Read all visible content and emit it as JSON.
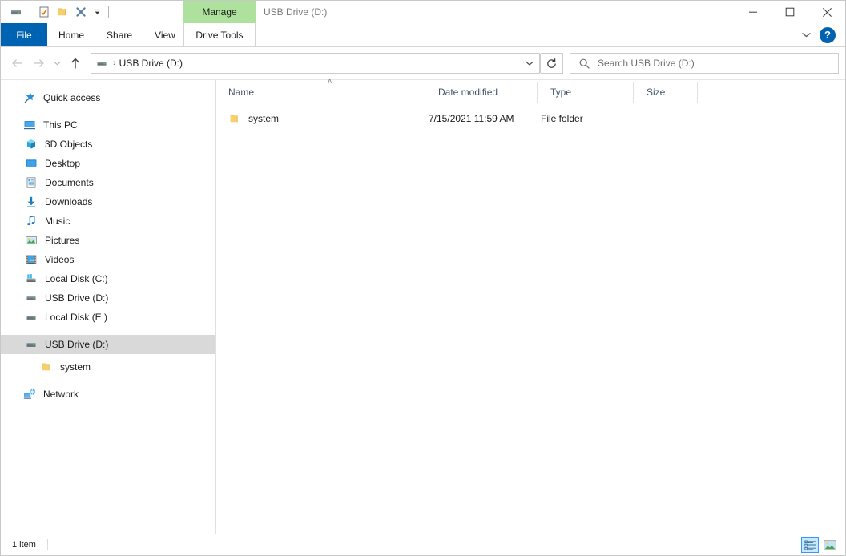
{
  "window": {
    "title": "USB Drive (D:)",
    "accent_blue": "#0063b1",
    "contextual_tab_green": "#aee19e",
    "selection_gray": "#d9d9d9"
  },
  "quick_access_toolbar": {
    "items": [
      {
        "name": "drive-icon",
        "label": "Properties"
      },
      {
        "name": "properties-icon",
        "label": "Properties"
      },
      {
        "name": "new-folder-icon",
        "label": "New folder"
      },
      {
        "name": "delete-icon",
        "label": "Delete"
      },
      {
        "name": "customize-dropdown-icon",
        "label": "Customize Quick Access Toolbar"
      }
    ]
  },
  "contextual_tab": {
    "group_label": "Manage",
    "tab_label": "Drive Tools"
  },
  "window_controls": {
    "minimize": "—",
    "maximize": "□",
    "close": "✕",
    "ribbon_collapse": "chevron-down-icon",
    "help": "?"
  },
  "ribbon": {
    "tabs": [
      {
        "label": "File",
        "active": false,
        "style": "file"
      },
      {
        "label": "Home",
        "active": false,
        "style": "normal"
      },
      {
        "label": "Share",
        "active": false,
        "style": "normal"
      },
      {
        "label": "View",
        "active": false,
        "style": "normal"
      }
    ]
  },
  "navigation": {
    "back_label": "Back",
    "forward_label": "Forward",
    "recent_label": "Recent locations",
    "up_label": "Up one level",
    "breadcrumb": {
      "icon": "drive-icon",
      "separator": "›",
      "path": "USB Drive (D:)"
    },
    "dropdown_label": "Previous locations",
    "refresh_label": "Refresh"
  },
  "search": {
    "placeholder": "Search USB Drive (D:)",
    "value": "",
    "icon": "search-icon"
  },
  "sidebar": {
    "items": [
      {
        "label": "Quick access",
        "icon": "star-pin-icon",
        "indent": 0,
        "selected": false,
        "gap_after": true
      },
      {
        "label": "This PC",
        "icon": "this-pc-icon",
        "indent": 0,
        "selected": false,
        "gap_after": false
      },
      {
        "label": "3D Objects",
        "icon": "3d-objects-icon",
        "indent": 1,
        "selected": false,
        "gap_after": false
      },
      {
        "label": "Desktop",
        "icon": "desktop-icon",
        "indent": 1,
        "selected": false,
        "gap_after": false
      },
      {
        "label": "Documents",
        "icon": "documents-icon",
        "indent": 1,
        "selected": false,
        "gap_after": false
      },
      {
        "label": "Downloads",
        "icon": "downloads-icon",
        "indent": 1,
        "selected": false,
        "gap_after": false
      },
      {
        "label": "Music",
        "icon": "music-icon",
        "indent": 1,
        "selected": false,
        "gap_after": false
      },
      {
        "label": "Pictures",
        "icon": "pictures-icon",
        "indent": 1,
        "selected": false,
        "gap_after": false
      },
      {
        "label": "Videos",
        "icon": "videos-icon",
        "indent": 1,
        "selected": false,
        "gap_after": false
      },
      {
        "label": "Local Disk (C:)",
        "icon": "system-drive-icon",
        "indent": 1,
        "selected": false,
        "gap_after": false
      },
      {
        "label": "USB Drive (D:)",
        "icon": "drive-icon",
        "indent": 1,
        "selected": false,
        "gap_after": false
      },
      {
        "label": "Local Disk (E:)",
        "icon": "drive-icon",
        "indent": 1,
        "selected": false,
        "gap_after": true
      },
      {
        "label": "USB Drive (D:)",
        "icon": "drive-icon",
        "indent": 0,
        "selected": true,
        "gap_after": false
      },
      {
        "label": "system",
        "icon": "folder-icon",
        "indent": 2,
        "selected": false,
        "gap_after": true
      },
      {
        "label": "Network",
        "icon": "network-icon",
        "indent": 0,
        "selected": false,
        "gap_after": false
      }
    ]
  },
  "file_list": {
    "columns": [
      {
        "key": "name",
        "label": "Name",
        "sorted": true,
        "sort_direction": "ascending"
      },
      {
        "key": "date",
        "label": "Date modified",
        "sorted": false,
        "sort_direction": ""
      },
      {
        "key": "type",
        "label": "Type",
        "sorted": false,
        "sort_direction": ""
      },
      {
        "key": "size",
        "label": "Size",
        "sorted": false,
        "sort_direction": ""
      }
    ],
    "sort_indicator": "˄",
    "rows": [
      {
        "name": "system",
        "date": "7/15/2021 11:59 AM",
        "type": "File folder",
        "size": "",
        "icon": "folder-icon"
      }
    ]
  },
  "status_bar": {
    "item_count": "1 item",
    "views": [
      {
        "name": "details-view-button",
        "label": "Details view",
        "active": true
      },
      {
        "name": "large-icons-view-button",
        "label": "Large icons view",
        "active": false
      }
    ]
  }
}
